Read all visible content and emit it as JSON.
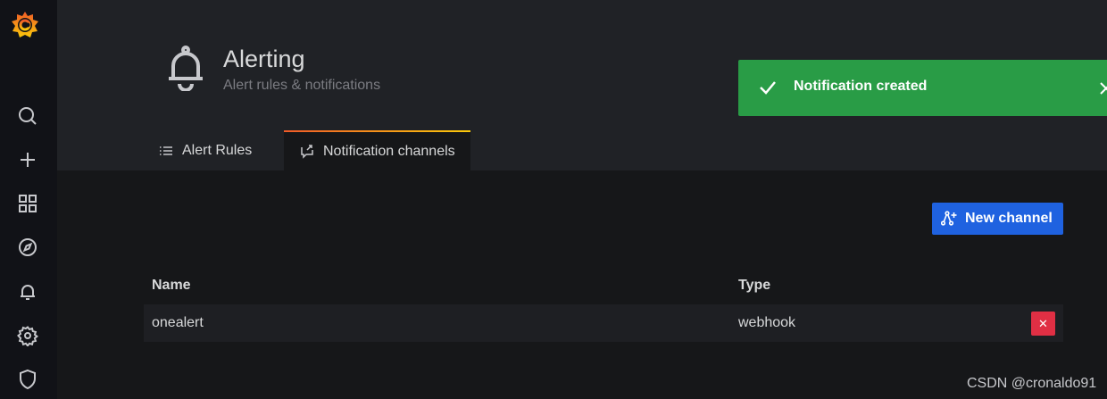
{
  "page": {
    "title": "Alerting",
    "subtitle": "Alert rules & notifications"
  },
  "tabs": [
    {
      "label": "Alert Rules",
      "icon": "list-icon",
      "active": false
    },
    {
      "label": "Notification channels",
      "icon": "comment-alt-share-icon",
      "active": true
    }
  ],
  "toast": {
    "message": "Notification created",
    "icon": "check-icon",
    "color": "#299c46"
  },
  "actions": {
    "new_channel_label": "New channel"
  },
  "table": {
    "columns": [
      "Name",
      "Type"
    ],
    "rows": [
      {
        "name": "onealert",
        "type": "webhook"
      }
    ]
  },
  "colors": {
    "primary": "#1f62e0",
    "danger": "#e02f44",
    "sidebar": "#111217",
    "background": "#161719"
  },
  "watermark": "CSDN @cronaldo91"
}
